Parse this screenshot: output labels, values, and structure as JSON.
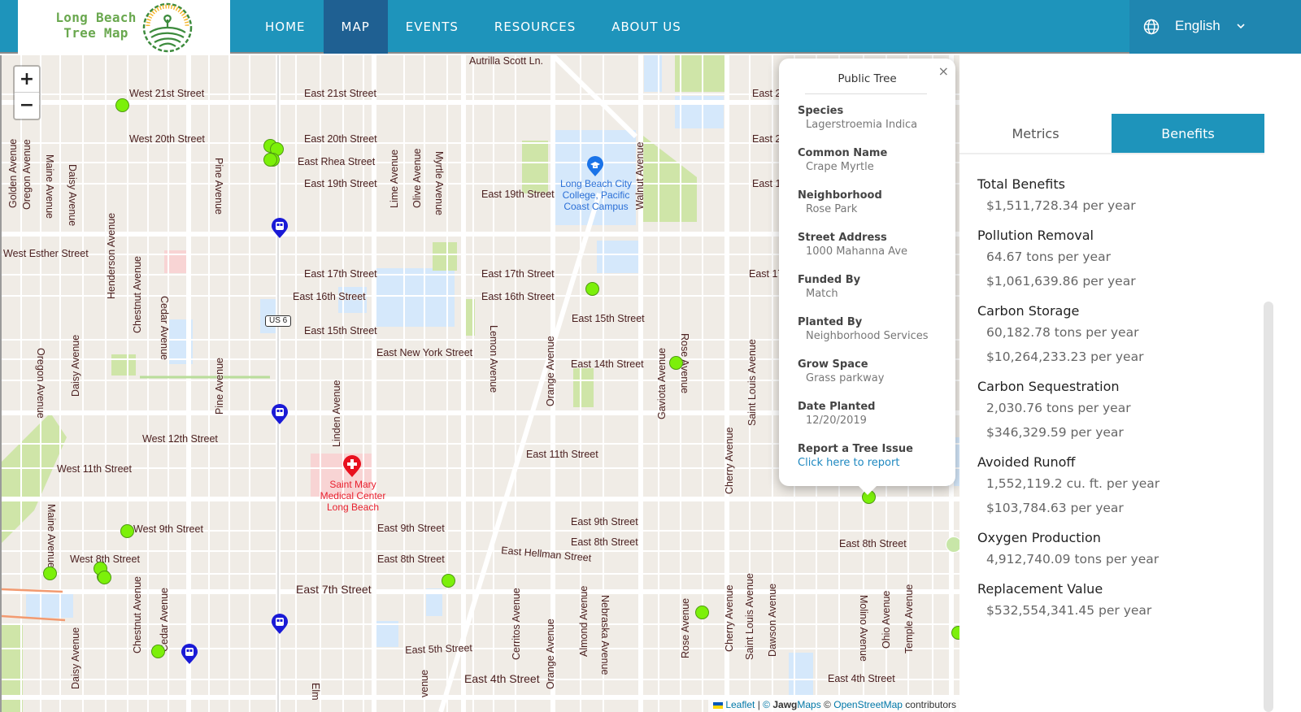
{
  "header": {
    "logo_line1": "Long Beach",
    "logo_line2": "Tree Map",
    "nav": [
      {
        "label": "HOME",
        "active": false
      },
      {
        "label": "MAP",
        "active": true
      },
      {
        "label": "EVENTS",
        "active": false
      },
      {
        "label": "RESOURCES",
        "active": false
      },
      {
        "label": "ABOUT US",
        "active": false
      }
    ],
    "language": {
      "icon": "globe-icon",
      "selected": "English",
      "chevron": "chevron-down-icon"
    }
  },
  "map": {
    "zoom_in": "+",
    "zoom_out": "−",
    "route_shield": "US 6",
    "streets": {
      "autrilla": "Autrilla Scott Ln.",
      "w21": "West 21st Street",
      "e21": "East 21st Street",
      "w20": "West 20th Street",
      "e20": "East 20th Street",
      "rhea": "East Rhea Street",
      "e19a": "East 19th Street",
      "e19b": "East 19th Street",
      "esther": "West Esther Street",
      "e17a": "East 17th Street",
      "e17b": "East 17th Street",
      "e16a": "East 16th Street",
      "e16b": "East 16th Street",
      "e15a": "East 15th Street",
      "e15b": "East 15th Street",
      "newyork": "East New York Street",
      "e14": "East 14th Street",
      "w12": "West 12th Street",
      "w11": "West 11th Street",
      "e11": "East 11th Street",
      "w9": "West 9th Street",
      "e9a": "East 9th Street",
      "e9b": "East 9th Street",
      "w8": "West 8th Street",
      "e8a": "East 8th Street",
      "e8b": "East 8th Street",
      "e8c": "East 8th Street",
      "hellman": "East Hellman Street",
      "e7": "East 7th Street",
      "e5": "East 5th Street",
      "e4a": "East 4th Street",
      "e4b": "East 4th Street",
      "e21r": "East 2",
      "e20r": "East 2",
      "e19r": "East 1",
      "e17r": "East 17",
      "golden": "Golden Avenue",
      "oregon1": "Oregon Avenue",
      "maine1": "Maine Avenue",
      "daisy1": "Daisy Avenue",
      "pine1": "Pine Avenue",
      "lime": "Lime Avenue",
      "olive": "Olive Avenue",
      "myrtle": "Myrtle Avenue",
      "walnut": "Walnut Avenue",
      "henderson": "Henderson Avenue",
      "chestnut1": "Chestnut Avenue",
      "cedar1": "Cedar Avenue",
      "oregon2": "Oregon Avenue",
      "daisy2": "Daisy Avenue",
      "pine2": "Pine Avenue",
      "linden": "Linden Avenue",
      "lemon": "Lemon Avenue",
      "orange1": "Orange Avenue",
      "gaviota": "Gaviota Avenue",
      "rose1": "Rose Avenue",
      "stlouis1": "Saint Louis Avenue",
      "cherry1": "Cherry Avenue",
      "maine2": "Maine Avenue",
      "chestnut2": "Chestnut Avenue",
      "cedar2": "Cedar Avenue",
      "daisy3": "Daisy Avenue",
      "cerritos": "Cerritos Avenue",
      "orange2": "Orange Avenue",
      "almond": "Almond Avenue",
      "nebraska": "Nebraska Avenue",
      "rose2": "Rose Avenue",
      "cherry2": "Cherry Avenue",
      "stlouis2": "Saint Louis Avenue",
      "dawson": "Dawson Avenue",
      "molino": "Molino Avenue",
      "ohio": "Ohio Avenue",
      "temple": "Temple Avenue",
      "elm": "Elm",
      "atlantic": "venue"
    },
    "pois": {
      "college": "Long Beach City College, Pacific Coast Campus",
      "hospital": "Saint Mary Medical Center Long Beach"
    },
    "attribution": {
      "leaflet": "Leaflet",
      "sep": "|",
      "copy1": "©",
      "jawg_bold": "Jawg",
      "jawg_rest": "Maps",
      "copy2": "©",
      "osm": "OpenStreetMap",
      "contributors": "contributors"
    }
  },
  "popup": {
    "title": "Public Tree",
    "close": "×",
    "fields": [
      {
        "label": "Species",
        "value": "Lagerstroemia Indica"
      },
      {
        "label": "Common Name",
        "value": "Crape Myrtle"
      },
      {
        "label": "Neighborhood",
        "value": "Rose Park"
      },
      {
        "label": "Street Address",
        "value": "1000 Mahanna Ave"
      },
      {
        "label": "Funded By",
        "value": "Match"
      },
      {
        "label": "Planted By",
        "value": "Neighborhood Services"
      },
      {
        "label": "Grow Space",
        "value": "Grass parkway"
      },
      {
        "label": "Date Planted",
        "value": "12/20/2019"
      }
    ],
    "report_label": "Report a Tree Issue",
    "report_link": "Click here to report"
  },
  "panel": {
    "tabs": [
      {
        "label": "Metrics",
        "active": false
      },
      {
        "label": "Benefits",
        "active": true
      }
    ],
    "benefits": [
      {
        "title": "Total Benefits",
        "values": [
          "$1,511,728.34 per year"
        ]
      },
      {
        "title": "Pollution Removal",
        "values": [
          "64.67 tons per year",
          "$1,061,639.86 per year"
        ]
      },
      {
        "title": "Carbon Storage",
        "values": [
          "60,182.78 tons per year",
          "$10,264,233.23 per year"
        ]
      },
      {
        "title": "Carbon Sequestration",
        "values": [
          "2,030.76 tons per year",
          "$346,329.59 per year"
        ]
      },
      {
        "title": "Avoided Runoff",
        "values": [
          "1,552,119.2 cu. ft. per year",
          "$103,784.63 per year"
        ]
      },
      {
        "title": "Oxygen Production",
        "values": [
          "4,912,740.09 tons per year"
        ]
      },
      {
        "title": "Replacement Value",
        "values": [
          "$532,554,341.45 per year"
        ]
      }
    ]
  },
  "colors": {
    "header": "#1e94bb",
    "nav_active": "#1f6092",
    "tab_active": "#1e94bb",
    "tree_marker": "#7cf00a",
    "bus_marker": "#1a1ad6",
    "hospital": "#e8101e",
    "link": "#1e88c0"
  }
}
